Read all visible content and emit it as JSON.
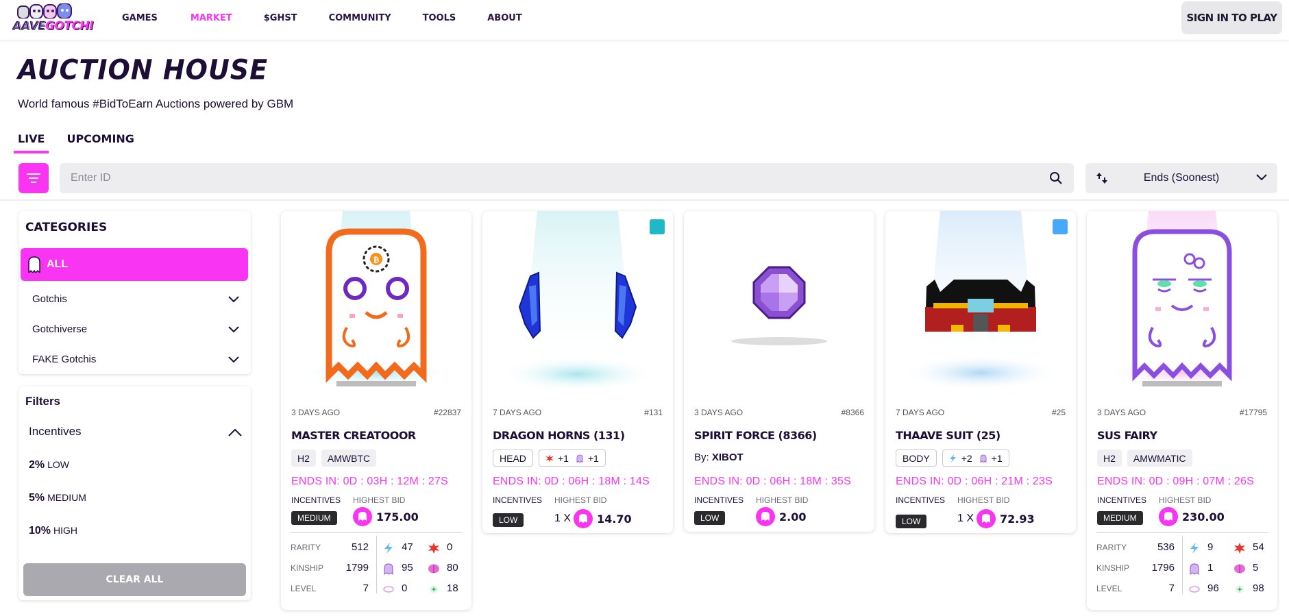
{
  "header": {
    "logo": "AAVEGOTCHI",
    "logo_parts": [
      "AAVE",
      "GOTCHI"
    ],
    "nav": [
      {
        "label": "GAMES",
        "active": false
      },
      {
        "label": "MARKET",
        "active": true
      },
      {
        "label": "$GHST",
        "active": false
      },
      {
        "label": "COMMUNITY",
        "active": false
      },
      {
        "label": "TOOLS",
        "active": false
      },
      {
        "label": "ABOUT",
        "active": false
      }
    ],
    "signin_label": "SIGN IN TO PLAY"
  },
  "page": {
    "title": "AUCTION HOUSE",
    "subtitle": "World famous #BidToEarn Auctions powered by GBM",
    "tabs": [
      {
        "label": "LIVE",
        "active": true
      },
      {
        "label": "UPCOMING",
        "active": false
      }
    ]
  },
  "search": {
    "placeholder": "Enter ID",
    "sort_selected": "Ends (Soonest)"
  },
  "sidebar": {
    "categories_title": "CATEGORIES",
    "all_label": "ALL",
    "categories": [
      "Gotchis",
      "Gotchiverse",
      "FAKE Gotchis"
    ],
    "filters_title": "Filters",
    "incentives_title": "Incentives",
    "incentive_options": [
      {
        "pct": "2%",
        "level": "LOW"
      },
      {
        "pct": "5%",
        "level": "MEDIUM"
      },
      {
        "pct": "10%",
        "level": "HIGH"
      }
    ],
    "clear_label": "CLEAR ALL"
  },
  "colors": {
    "accent": "#fa34f3",
    "text": "#1c0e36",
    "badge_teal": "#20b8c8",
    "badge_blue": "#4aa8f8"
  },
  "labels": {
    "incentives": "INCENTIVES",
    "highest_bid": "HIGHEST BID",
    "rarity": "RARITY",
    "kinship": "KINSHIP",
    "level": "LEVEL"
  },
  "cards": [
    {
      "time_ago": "3 DAYS AGO",
      "id": "#22837",
      "name": "MASTER CREATOOOR",
      "tags": [
        "H2",
        "AMWBTC"
      ],
      "ends": "ENDS IN: 0D : 03H : 12M : 27S",
      "incentive": "MEDIUM",
      "bid": "175.00",
      "stats": {
        "rarity": "512",
        "kinship": "1799",
        "level": "7"
      },
      "traits": [
        "47",
        "0",
        "95",
        "80",
        "0",
        "18"
      ],
      "art": "gotchi-orange"
    },
    {
      "time_ago": "7 DAYS AGO",
      "id": "#131",
      "name": "DRAGON HORNS (131)",
      "tags": [
        "HEAD"
      ],
      "mods": [
        "+1",
        "+1"
      ],
      "ends": "ENDS IN: 0D : 06H : 18M : 14S",
      "incentive": "LOW",
      "multiplier": "1 X",
      "bid": "14.70",
      "art": "dragon-horns",
      "badge": "teal"
    },
    {
      "time_ago": "3 DAYS AGO",
      "id": "#8366",
      "name": "SPIRIT FORCE (8366)",
      "by_label": "By:",
      "by": "XIBOT",
      "ends": "ENDS IN: 0D : 06H : 18M : 35S",
      "incentive": "LOW",
      "bid": "2.00",
      "art": "spirit-force"
    },
    {
      "time_ago": "7 DAYS AGO",
      "id": "#25",
      "name": "THAAVE SUIT (25)",
      "tags": [
        "BODY"
      ],
      "mods": [
        "+2",
        "+1"
      ],
      "ends": "ENDS IN: 0D : 06H : 21M : 23S",
      "incentive": "LOW",
      "multiplier": "1 X",
      "bid": "72.93",
      "art": "thaave-suit",
      "badge": "blue"
    },
    {
      "time_ago": "3 DAYS AGO",
      "id": "#17795",
      "name": "SUS FAIRY",
      "tags": [
        "H2",
        "AMWMATIC"
      ],
      "ends": "ENDS IN: 0D : 09H : 07M : 26S",
      "incentive": "MEDIUM",
      "bid": "230.00",
      "stats": {
        "rarity": "536",
        "kinship": "1796",
        "level": "7"
      },
      "traits": [
        "9",
        "54",
        "1",
        "5",
        "96",
        "98"
      ],
      "art": "gotchi-purple"
    }
  ]
}
